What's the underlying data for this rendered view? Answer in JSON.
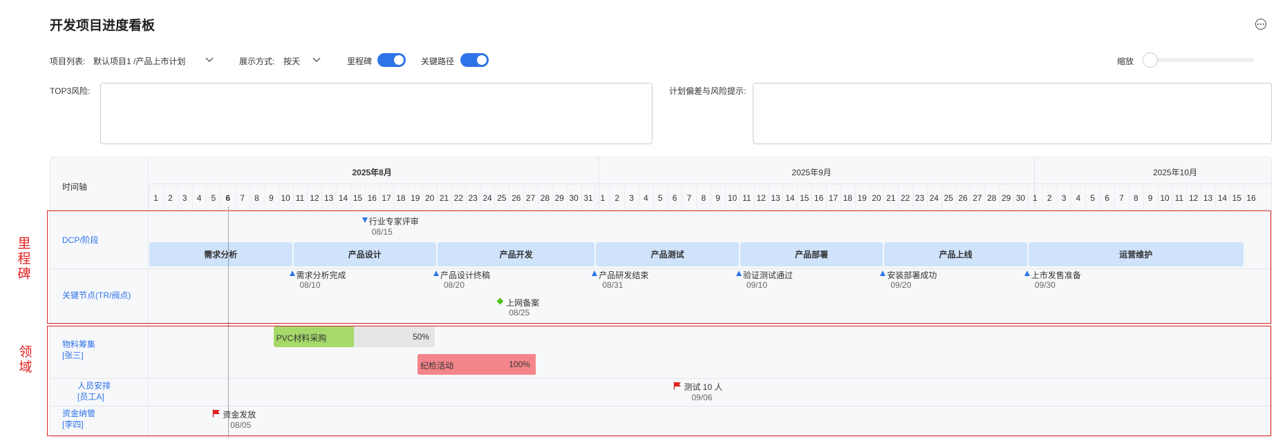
{
  "header": {
    "title": "开发项目进度看板"
  },
  "controls": {
    "project_label": "项目列表:",
    "project_value": "默认项目1 /产品上市计划",
    "display_label": "展示方式:",
    "display_value": "按天",
    "milestone_label": "里程碑",
    "critical_label": "关键路径",
    "zoom_label": "缩放",
    "milestone_on": true,
    "critical_on": true
  },
  "risk": {
    "top3_label": "TOP3风险:",
    "deviation_label": "计划偏差与风险提示:"
  },
  "timeline": {
    "axis_label": "时间轴",
    "months": [
      {
        "label": "2025年8月",
        "bold": true,
        "days": 31
      },
      {
        "label": "2025年9月",
        "bold": false,
        "days": 30
      },
      {
        "label": "2025年10月",
        "bold": false,
        "days": 16
      }
    ],
    "today_day": 6
  },
  "rows": {
    "dcp": "DCP/阶段",
    "keynodes": "关键节点(TR/阀点)",
    "material": {
      "name": "物料筹集",
      "owner": "[张三]"
    },
    "personnel": {
      "name": "人员安排",
      "owner": "[员工A]"
    },
    "funds": {
      "name": "资金纳管",
      "owner": "[李四]"
    }
  },
  "phases": [
    {
      "name": "需求分析",
      "start": 0,
      "end": 10
    },
    {
      "name": "产品设计",
      "start": 10,
      "end": 20
    },
    {
      "name": "产品开发",
      "start": 20,
      "end": 31
    },
    {
      "name": "产品测试",
      "start": 31,
      "end": 41
    },
    {
      "name": "产品部署",
      "start": 41,
      "end": 51
    },
    {
      "name": "产品上线",
      "start": 51,
      "end": 61
    },
    {
      "name": "运营维护",
      "start": 61,
      "end": 76
    }
  ],
  "review": {
    "name": "行业专家评审",
    "date": "08/15",
    "day": 15
  },
  "keynodes": [
    {
      "name": "需求分析完成",
      "date": "08/10",
      "day": 10
    },
    {
      "name": "产品设计终稿",
      "date": "08/20",
      "day": 20
    },
    {
      "name": "产品研发结束",
      "date": "08/31",
      "day": 31
    },
    {
      "name": "验证测试通过",
      "date": "09/10",
      "day": 41
    },
    {
      "name": "安装部署成功",
      "date": "09/20",
      "day": 51
    },
    {
      "name": "上市发售准备",
      "date": "09/30",
      "day": 61
    }
  ],
  "filing": {
    "name": "上网备案",
    "date": "08/25",
    "day": 25
  },
  "bars": [
    {
      "name": "PVC材料采购",
      "pct": "50%",
      "progress": 0.5,
      "start": 9,
      "end": 20,
      "fill": "#a6d96a",
      "track": "#e6e6e6"
    },
    {
      "name": "纪检活动",
      "pct": "100%",
      "progress": 1.0,
      "start": 19,
      "end": 27,
      "fill": "#f4858a",
      "track": "#f4858a"
    }
  ],
  "flags": [
    {
      "name": "测试 10 人",
      "date": "09/06",
      "day": 37
    },
    {
      "name": "资金发放",
      "date": "08/05",
      "day": 5
    }
  ],
  "annotations": {
    "milestone": [
      "里",
      "程",
      "碑"
    ],
    "domain": [
      "领",
      "域"
    ]
  }
}
